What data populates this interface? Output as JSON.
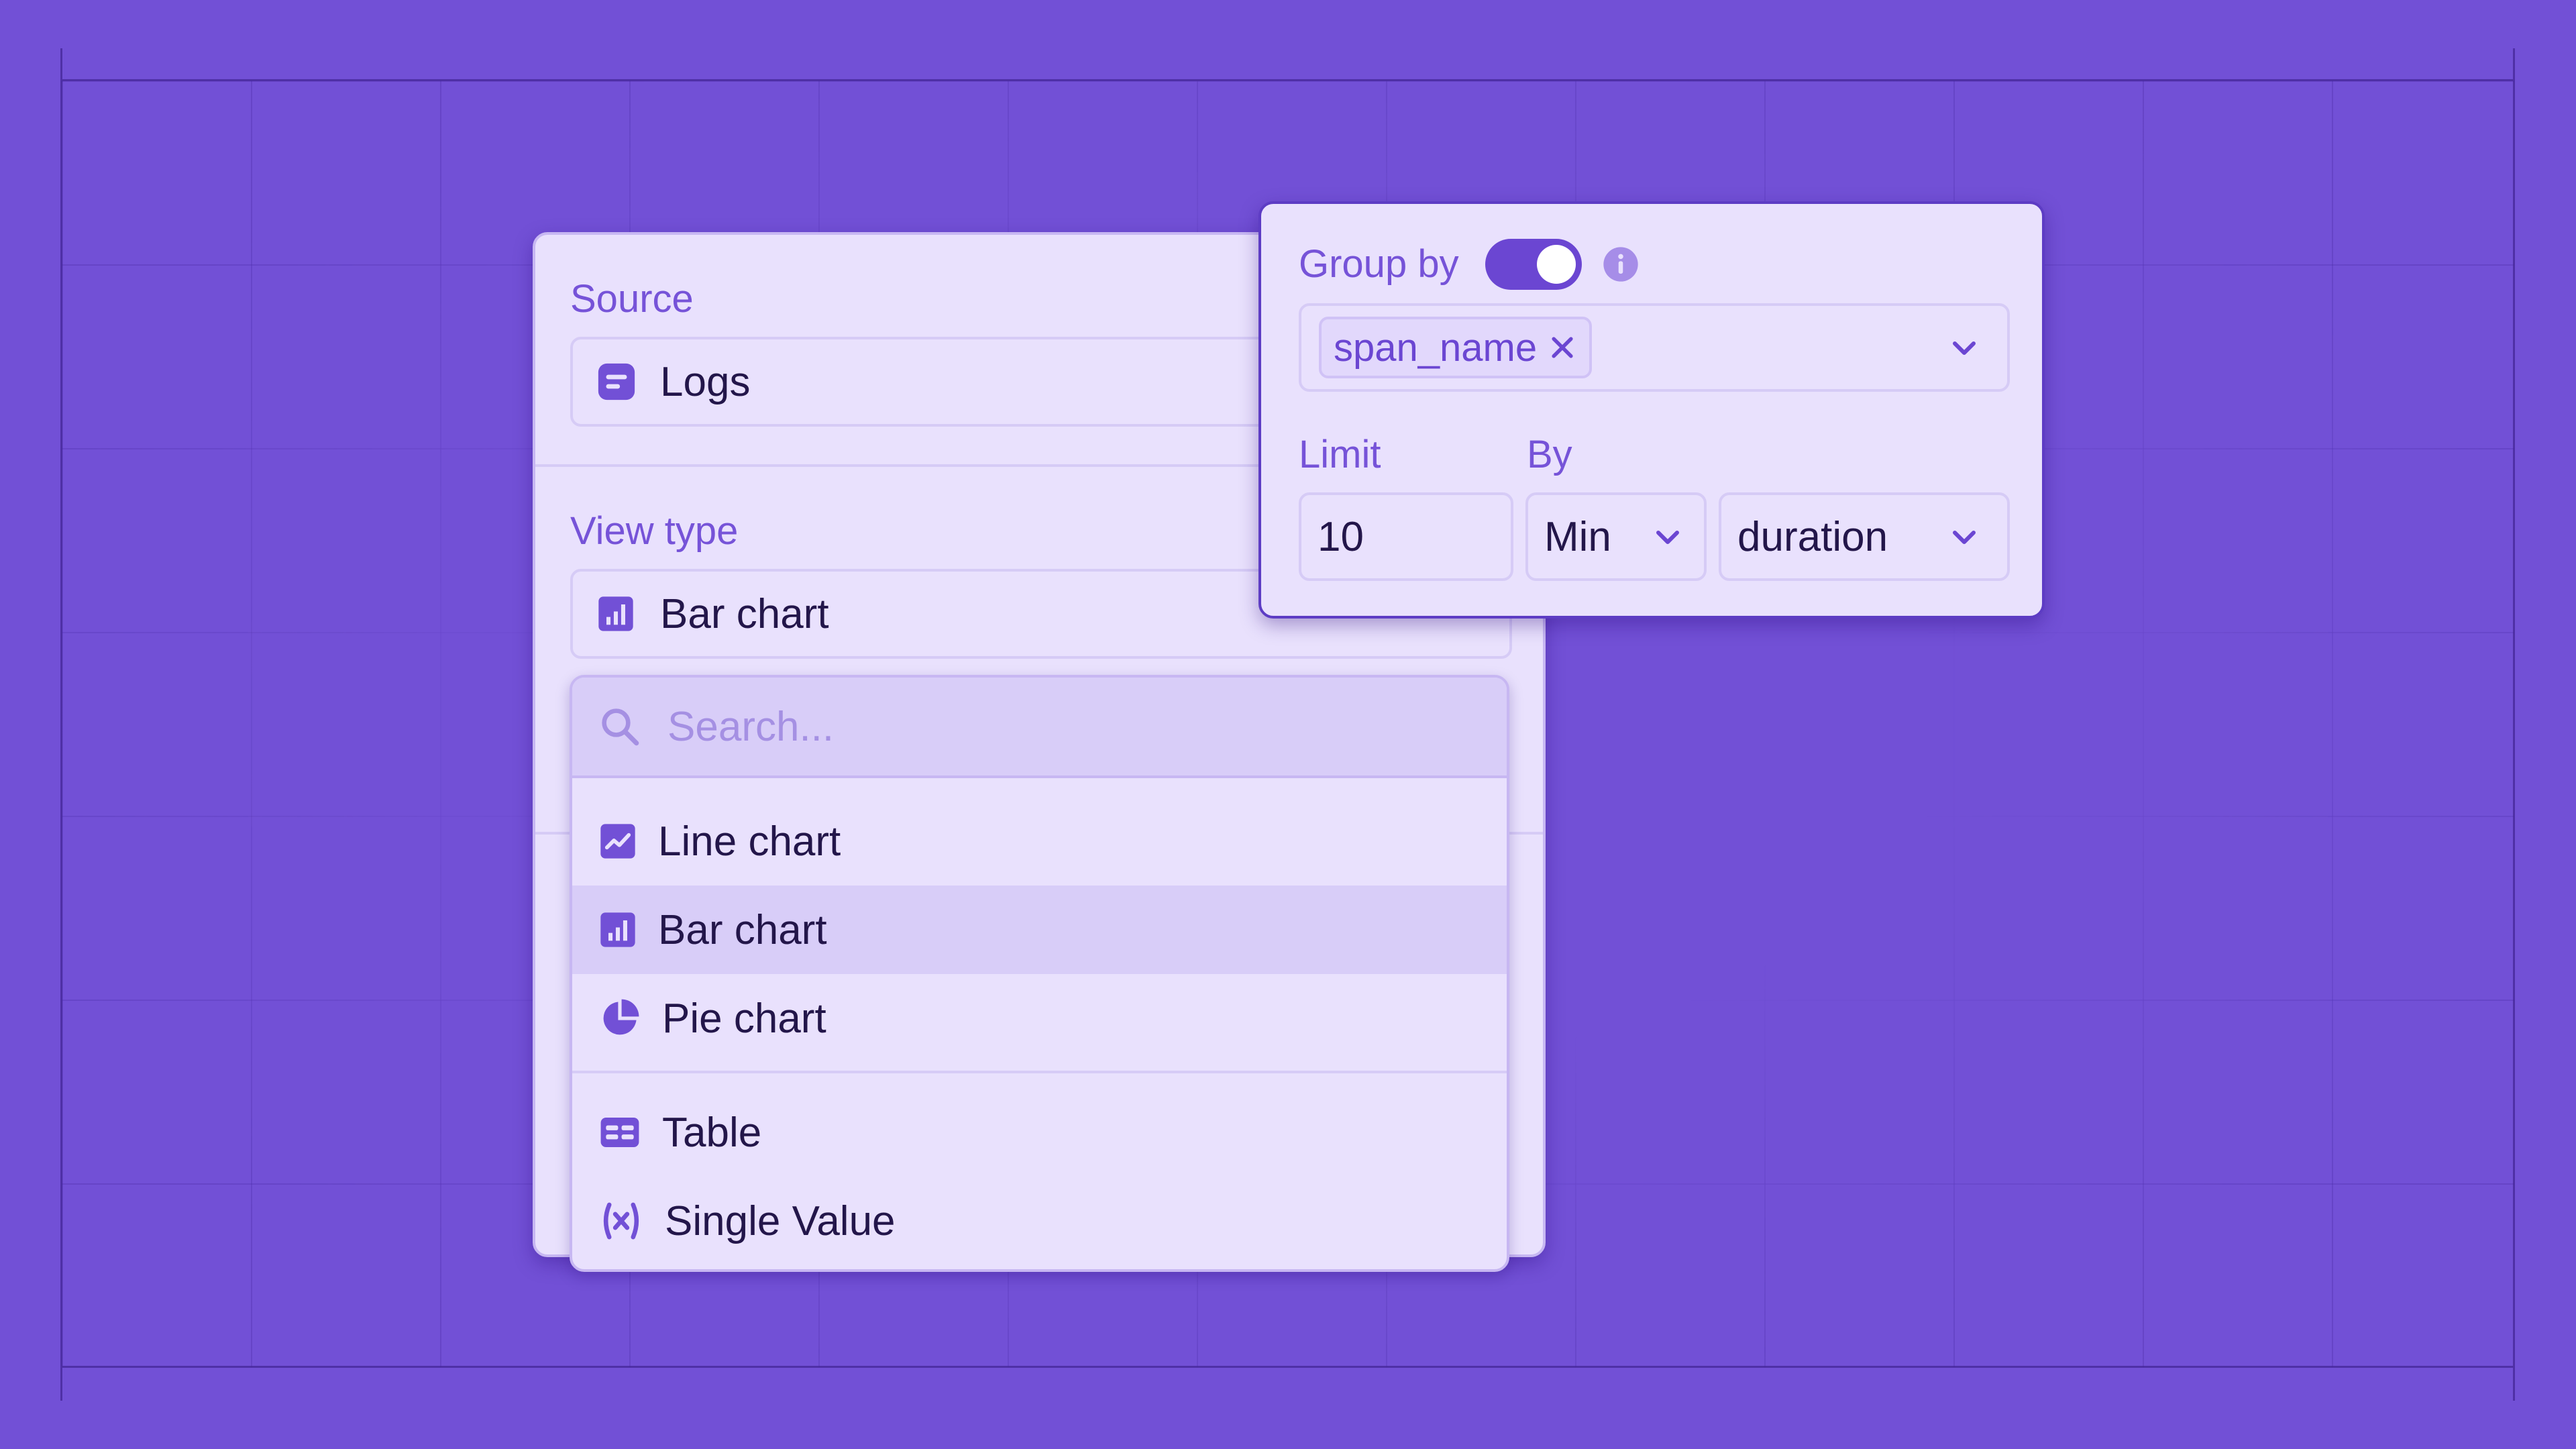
{
  "source": {
    "label": "Source",
    "value": "Logs",
    "icon": "logs-icon"
  },
  "view_type": {
    "label": "View type",
    "value": "Bar chart",
    "icon": "bar-chart-icon"
  },
  "dropdown": {
    "search_placeholder": "Search...",
    "items": [
      {
        "label": "Line chart",
        "icon": "line-chart-icon",
        "selected": false
      },
      {
        "label": "Bar chart",
        "icon": "bar-chart-icon",
        "selected": true
      },
      {
        "label": "Pie chart",
        "icon": "pie-chart-icon",
        "selected": false
      },
      {
        "label": "Table",
        "icon": "table-icon",
        "selected": false
      },
      {
        "label": "Single Value",
        "icon": "variable-icon",
        "selected": false
      }
    ]
  },
  "group_by": {
    "label": "Group by",
    "toggle_on": true,
    "tags": [
      "span_name"
    ]
  },
  "limit": {
    "label": "Limit",
    "value": "10"
  },
  "by": {
    "label": "By",
    "aggregate": "Min",
    "field": "duration"
  },
  "colors": {
    "background": "#7250d6",
    "accent": "#6b46d2",
    "panel": "#e9e1fd",
    "selected_row": "#d8cdf8",
    "text": "#23164a"
  }
}
